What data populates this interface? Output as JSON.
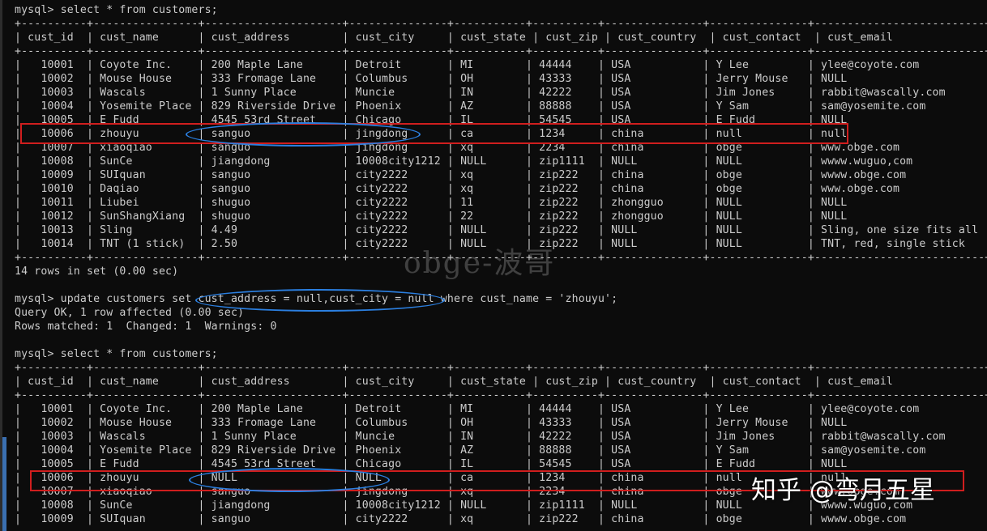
{
  "terminal": {
    "lines": [
      "mysql> select * from customers;",
      "+----------+----------------+---------------------+---------------+-----------+----------+---------------+---------------+--------------------------+",
      "| cust_id  | cust_name      | cust_address        | cust_city     | cust_state | cust_zip | cust_country  | cust_contact  | cust_email               |",
      "+----------+----------------+---------------------+---------------+-----------+----------+---------------+---------------+--------------------------+",
      "|   10001  | Coyote Inc.    | 200 Maple Lane      | Detroit       | MI        | 44444    | USA           | Y Lee         | ylee@coyote.com          |",
      "|   10002  | Mouse House    | 333 Fromage Lane    | Columbus      | OH        | 43333    | USA           | Jerry Mouse   | NULL                     |",
      "|   10003  | Wascals        | 1 Sunny Place       | Muncie        | IN        | 42222    | USA           | Jim Jones     | rabbit@wascally.com      |",
      "|   10004  | Yosemite Place | 829 Riverside Drive | Phoenix       | AZ        | 88888    | USA           | Y Sam         | sam@yosemite.com         |",
      "|   10005  | E Fudd         | 4545 53rd Street    | Chicago       | IL        | 54545    | USA           | E Fudd        | NULL                     |",
      "|   10006  | zhouyu         | sanguo              | jingdong      | ca        | 1234     | china         | null          | null                     |",
      "|   10007  | xiaoqiao       | sanguo              | jingdong      | xq        | 2234     | china         | obge          | www.obge.com             |",
      "|   10008  | SunCe          | jiangdong           | 10008city1212 | NULL      | zip1111  | NULL          | NULL          | wwww.wuguo,com           |",
      "|   10009  | SUIquan        | sanguo              | city2222      | xq        | zip222   | china         | obge          | wwww.obge.com            |",
      "|   10010  | Daqiao         | sanguo              | city2222      | xq        | zip222   | china         | obge          | www.obge.com             |",
      "|   10011  | Liubei         | shuguo              | city2222      | 11        | zip222   | zhongguo      | NULL          | NULL                     |",
      "|   10012  | SunShangXiang  | shuguo              | city2222      | 22        | zip222   | zhongguo      | NULL          | NULL                     |",
      "|   10013  | Sling          | 4.49                | city2222      | NULL      | zip222   | NULL          | NULL          | Sling, one size fits all |",
      "|   10014  | TNT (1 stick)  | 2.50                | city2222      | NULL      | zip222   | NULL          | NULL          | TNT, red, single stick   |",
      "+----------+----------------+---------------------+---------------+-----------+----------+---------------+---------------+--------------------------+",
      "14 rows in set (0.00 sec)",
      "",
      "mysql> update customers set cust_address = null,cust_city = null where cust_name = 'zhouyu';",
      "Query OK, 1 row affected (0.00 sec)",
      "Rows matched: 1  Changed: 1  Warnings: 0",
      "",
      "mysql> select * from customers;",
      "+----------+----------------+---------------------+---------------+-----------+----------+---------------+---------------+--------------------------+",
      "| cust_id  | cust_name      | cust_address        | cust_city     | cust_state | cust_zip | cust_country  | cust_contact  | cust_email               |",
      "+----------+----------------+---------------------+---------------+-----------+----------+---------------+---------------+--------------------------+",
      "|   10001  | Coyote Inc.    | 200 Maple Lane      | Detroit       | MI        | 44444    | USA           | Y Lee         | ylee@coyote.com          |",
      "|   10002  | Mouse House    | 333 Fromage Lane    | Columbus      | OH        | 43333    | USA           | Jerry Mouse   | NULL                     |",
      "|   10003  | Wascals        | 1 Sunny Place       | Muncie        | IN        | 42222    | USA           | Jim Jones     | rabbit@wascally.com      |",
      "|   10004  | Yosemite Place | 829 Riverside Drive | Phoenix       | AZ        | 88888    | USA           | Y Sam         | sam@yosemite.com         |",
      "|   10005  | E Fudd         | 4545 53rd Street    | Chicago       | IL        | 54545    | USA           | E Fudd        | NULL                     |",
      "|   10006  | zhouyu         | NULL                | NULL          | ca        | 1234     | china         | null          | null                     |",
      "|   10007  | xiaoqiao       | sanguo              | jingdong      | xq        | 2234     | china         | obge          | www.obge.com             |",
      "|   10008  | SunCe          | jiangdong           | 10008city1212 | NULL      | zip1111  | NULL          | NULL          | wwww.wuguo,com           |",
      "|   10009  | SUIquan        | sanguo              | city2222      | xq        | zip222   | china         | obge          | wwww.obge.com            |"
    ]
  },
  "watermark": "obge-波哥",
  "zhihu_credit": "知乎 @弯月五星",
  "colors": {
    "background": "#0c0c0c",
    "text": "#cccccc",
    "highlight_box": "#d01e1e",
    "highlight_ellipse": "#2b7fe0"
  }
}
